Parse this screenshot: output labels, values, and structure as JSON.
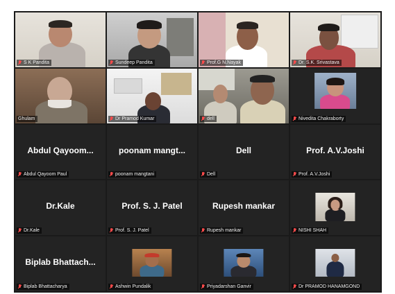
{
  "participants": [
    {
      "label": "S K Pandita",
      "type": "video"
    },
    {
      "label": "Sundeep Pandita",
      "type": "video"
    },
    {
      "label": "Prof.G N.Nayak",
      "type": "video"
    },
    {
      "label": "Dr. S.K. Srivastava",
      "type": "video"
    },
    {
      "label": "Ghulam",
      "type": "video",
      "active": true
    },
    {
      "label": "Dr Pramod Kumar",
      "type": "video"
    },
    {
      "label": "dell",
      "type": "video"
    },
    {
      "label": "Nivedita Chakraborty",
      "type": "video"
    },
    {
      "label": "Abdul Qayoom Paul",
      "display": "Abdul Qayoom...",
      "type": "name"
    },
    {
      "label": "poonam mangtani",
      "display": "poonam mangt...",
      "type": "name"
    },
    {
      "label": "Dell",
      "display": "Dell",
      "type": "name"
    },
    {
      "label": "Prof. A.V.Joshi",
      "display": "Prof. A.V.Joshi",
      "type": "name"
    },
    {
      "label": "Dr.Kale",
      "display": "Dr.Kale",
      "type": "name"
    },
    {
      "label": "Prof. S. J. Patel",
      "display": "Prof. S. J. Patel",
      "type": "name"
    },
    {
      "label": "Rupesh mankar",
      "display": "Rupesh mankar",
      "type": "name"
    },
    {
      "label": "NISHI SHAH",
      "type": "avatar"
    },
    {
      "label": "Biplab Bhattacharya",
      "display": "Biplab Bhattach...",
      "type": "name"
    },
    {
      "label": "Ashwin Pundalik",
      "type": "avatar"
    },
    {
      "label": "Priyadarshan Ganvir",
      "type": "avatar"
    },
    {
      "label": "Dr PRAMOD HANAMGOND",
      "type": "avatar"
    }
  ],
  "colors": {
    "tile_background": "#232323",
    "active_speaker_border": "#b7d23a",
    "muted_mic": "#ff4b4b"
  },
  "icons": {
    "muted": "mic-off-icon"
  }
}
